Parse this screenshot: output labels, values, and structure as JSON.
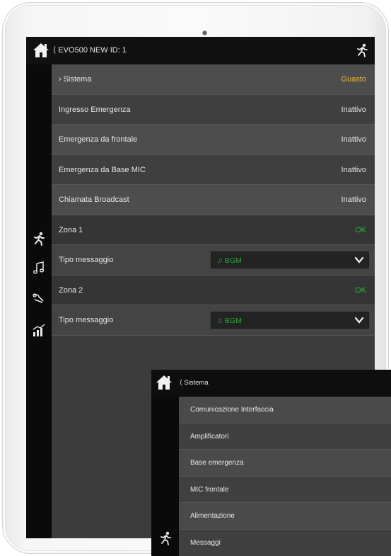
{
  "main": {
    "topbar": {
      "title": "⟨ EVO500 NEW ID: 1",
      "home_icon": "home-icon",
      "right_icon": "running-man-icon"
    },
    "sidebar": {
      "icons": [
        "running-man-icon",
        "music-note-icon",
        "microphone-icon",
        "bar-chart-icon"
      ]
    },
    "rows": [
      {
        "label": "› Sistema",
        "value": "Guasto",
        "status": "warn"
      },
      {
        "label": "Ingresso Emergenza",
        "value": "Inattivo"
      },
      {
        "label": "Emergenza da frontale",
        "value": "Inattivo"
      },
      {
        "label": "Emergenza da Base MIC",
        "value": "Inattivo"
      },
      {
        "label": "Chiamata Broadcast",
        "value": "Inattivo"
      },
      {
        "label": "Zona 1",
        "value": "OK",
        "status": "ok"
      },
      {
        "label": "Tipo messaggio",
        "select_value": "BGM"
      },
      {
        "label": "Zona 2",
        "value": "OK",
        "status": "ok"
      },
      {
        "label": "Tipo messaggio",
        "select_value": "BGM"
      }
    ]
  },
  "overlay": {
    "topbar": {
      "title": "⟨ Sistema",
      "home_icon": "home-icon"
    },
    "items": [
      "Comunicazione Interfaccia",
      "Amplificatori",
      "Base emergenza",
      "MIC frontale",
      "Alimentazione",
      "Messaggi"
    ]
  },
  "colors": {
    "warning": "#e6b93a",
    "ok": "#29b43a",
    "background": "#3c3c3c",
    "bar": "#111111"
  }
}
